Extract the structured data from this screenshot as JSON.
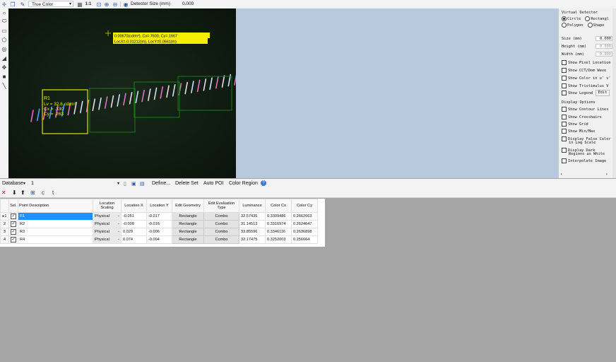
{
  "toolbar": {
    "color_mode": "True Color",
    "zoom_1to1": "1:1",
    "detector_size_label": "Detector Size (mm)",
    "detector_size_value": "0.000"
  },
  "image": {
    "tooltip_line1": "0.00670(cd/m²), Cx=.7600, Cy=.1667",
    "tooltip_line2": "LocX=-0.01212(m), LocY=0.0661(m)",
    "roi_label": "R1",
    "roi_lv": "Lv = 32.6 cd/m²",
    "roi_cx": "Cx = .330",
    "roi_cy": "Cy = .263"
  },
  "right_panel": {
    "virtual_detector_title": "Virtual Detector",
    "radio_circle": "Circle",
    "radio_rectangle": "Rectangl",
    "radio_polygon": "Polygon",
    "radio_shape": "Shape",
    "size_label": "Size (mm)",
    "size_value": "0.000",
    "height_label": "Height (mm)",
    "height_value": "0.000",
    "width_label": "Width (mm)",
    "width_value": "0.000",
    "show_pixel_location": "Show Pixel Location",
    "show_cct": "Show CCT/Dom Wave",
    "show_color_uv": "Show Color in u' v'",
    "show_tristimulus": "Show Tristimulus V",
    "show_legend": "Show Legend",
    "edit_label": "Edit",
    "display_options_title": "Display Options",
    "show_contour": "Show Contour Lines",
    "show_crosshairs": "Show Crosshairs",
    "show_grid": "Show Grid",
    "show_minmax": "Show Min/Max",
    "display_false_color_1": "Display False Color",
    "display_false_color_2": "in Log Scale",
    "display_dark_1": "Display Dark",
    "display_dark_2": "Regions as White",
    "interpolate_image": "Interpolate Image"
  },
  "database_bar": {
    "database_label": "Database",
    "database_value": "1",
    "define": "Define...",
    "delete_set": "Delete Set",
    "auto_poi": "Auto POI",
    "color_region": "Color Region"
  },
  "table": {
    "headers": {
      "sel": "Sel.",
      "point_description": "Point Description",
      "location_scaling": "Location Scaling",
      "location_x": "Location X",
      "location_y": "Location Y",
      "edit_geometry": "Edit Geometry",
      "edit_evaluation_type": "Edit Evaluation Type",
      "luminance": "Luminance",
      "color_cx": "Color Cx",
      "color_cy": "Color Cy"
    },
    "rows": [
      {
        "num": "▸1",
        "desc": "R1",
        "scaling": "Physical",
        "x": "-0.051",
        "y": "-0.017",
        "geom": "Rectangle",
        "eval": "Combo",
        "lum": "32.57435",
        "cx": "0.3309486",
        "cy": "0.2662663"
      },
      {
        "num": "2",
        "desc": "R2",
        "scaling": "Physical",
        "x": "-0.009",
        "y": "-0.016",
        "geom": "Rectangle",
        "eval": "Combo",
        "lum": "31.14513",
        "cx": "0.3316974",
        "cy": "0.2624647"
      },
      {
        "num": "3",
        "desc": "R3",
        "scaling": "Physical",
        "x": "0.029",
        "y": "-0.006",
        "geom": "Rectangle",
        "eval": "Combo",
        "lum": "33.85596",
        "cx": "0.3346116",
        "cy": "0.2636898"
      },
      {
        "num": "4",
        "desc": "R4",
        "scaling": "Physical",
        "x": "0.074",
        "y": "-0.004",
        "geom": "Rectangle",
        "eval": "Combo",
        "lum": "32.17475",
        "cx": "0.3252003",
        "cy": "0.256664"
      }
    ]
  }
}
